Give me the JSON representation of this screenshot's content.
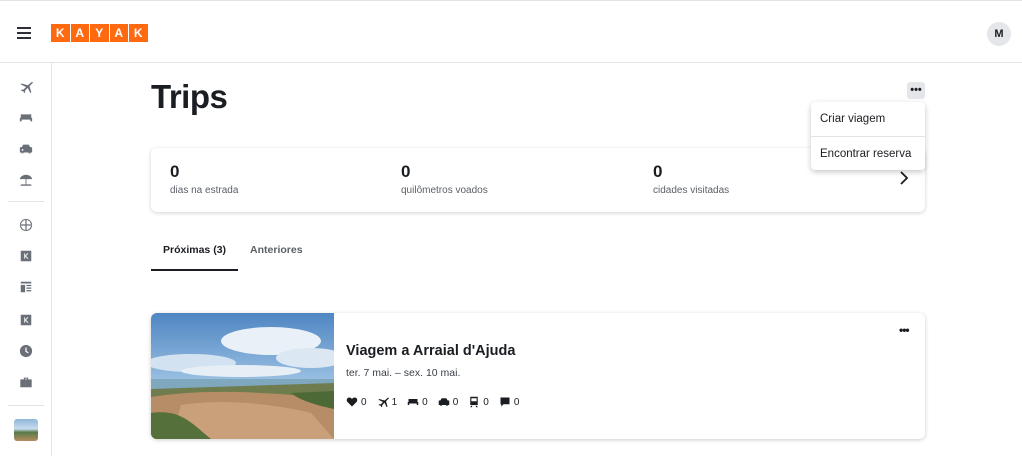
{
  "header": {
    "logo_letters": [
      "K",
      "A",
      "Y",
      "A",
      "K"
    ],
    "avatar_initial": "M",
    "brand_color": "#ff690f"
  },
  "sidebar": {
    "icons": [
      "plane-icon",
      "bed-icon",
      "car-icon",
      "beach-umbrella-icon",
      "globe-icon",
      "kayak-k-icon",
      "layout-icon",
      "kayak-k-icon",
      "clock-icon",
      "briefcase-icon"
    ]
  },
  "page": {
    "title": "Trips"
  },
  "menu": {
    "more_label": "•••",
    "items": [
      "Criar viagem",
      "Encontrar reserva"
    ]
  },
  "stats": [
    {
      "value": "0",
      "label": "dias na estrada"
    },
    {
      "value": "0",
      "label": "quilômetros voados"
    },
    {
      "value": "0",
      "label": "cidades visitadas"
    }
  ],
  "tabs": [
    {
      "label": "Próximas (3)",
      "active": true
    },
    {
      "label": "Anteriores",
      "active": false
    }
  ],
  "trip": {
    "title": "Viagem a Arraial d'Ajuda",
    "dates": "ter. 7 mai. – sex. 10 mai.",
    "more_label": "•••",
    "counts": [
      {
        "icon": "heart-icon",
        "value": "0"
      },
      {
        "icon": "plane-icon",
        "value": "1"
      },
      {
        "icon": "bed-icon",
        "value": "0"
      },
      {
        "icon": "car-icon",
        "value": "0"
      },
      {
        "icon": "train-icon",
        "value": "0"
      },
      {
        "icon": "comment-icon",
        "value": "0"
      }
    ]
  }
}
